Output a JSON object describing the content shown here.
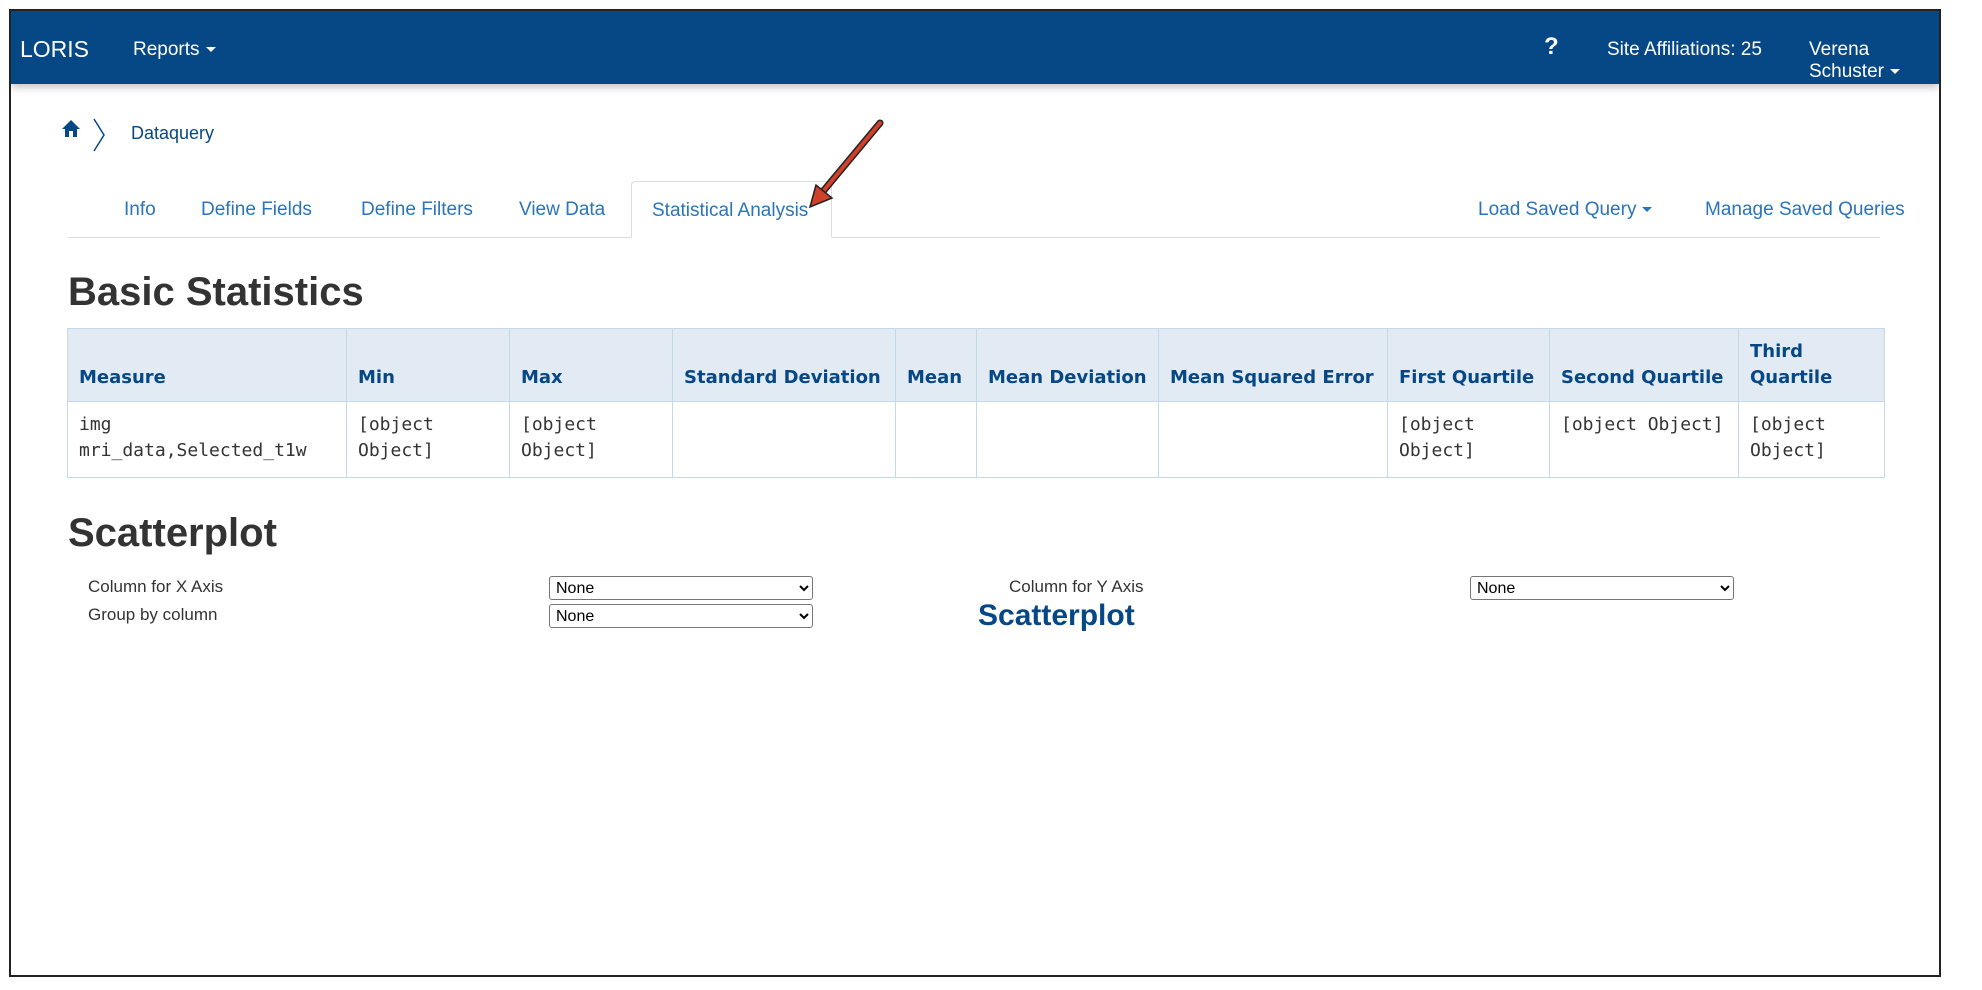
{
  "navbar": {
    "brand": "LORIS",
    "reports": "Reports",
    "help": "?",
    "site_affiliations": "Site Affiliations: 25",
    "user": "Verena Schuster"
  },
  "breadcrumb": {
    "current": "Dataquery"
  },
  "tabs": [
    {
      "label": "Info"
    },
    {
      "label": "Define Fields"
    },
    {
      "label": "Define Filters"
    },
    {
      "label": "View Data"
    },
    {
      "label": "Statistical Analysis",
      "active": true
    }
  ],
  "right_tabs": {
    "load_saved": "Load Saved Query",
    "manage_saved": "Manage Saved Queries"
  },
  "basic_statistics": {
    "heading": "Basic Statistics",
    "columns": [
      "Measure",
      "Min",
      "Max",
      "Standard Deviation",
      "Mean",
      "Mean Deviation",
      "Mean Squared Error",
      "First Quartile",
      "Second Quartile",
      "Third Quartile"
    ],
    "rows": [
      [
        "img mri_data,Selected_t1w",
        "[object Object]",
        "[object Object]",
        "",
        "",
        "",
        "",
        "[object Object]",
        "[object Object]",
        "[object Object]"
      ]
    ]
  },
  "scatterplot": {
    "heading": "Scatterplot",
    "x_label": "Column for X Axis",
    "x_value": "None",
    "y_label": "Column for Y Axis",
    "y_value": "None",
    "group_label": "Group by column",
    "group_value": "None",
    "plot_title": "Scatterplot"
  },
  "colors": {
    "navbar": "#064785",
    "link": "#2a74b8",
    "table_header_bg": "#e2ebf3",
    "annotation_arrow": "#d0412b"
  }
}
